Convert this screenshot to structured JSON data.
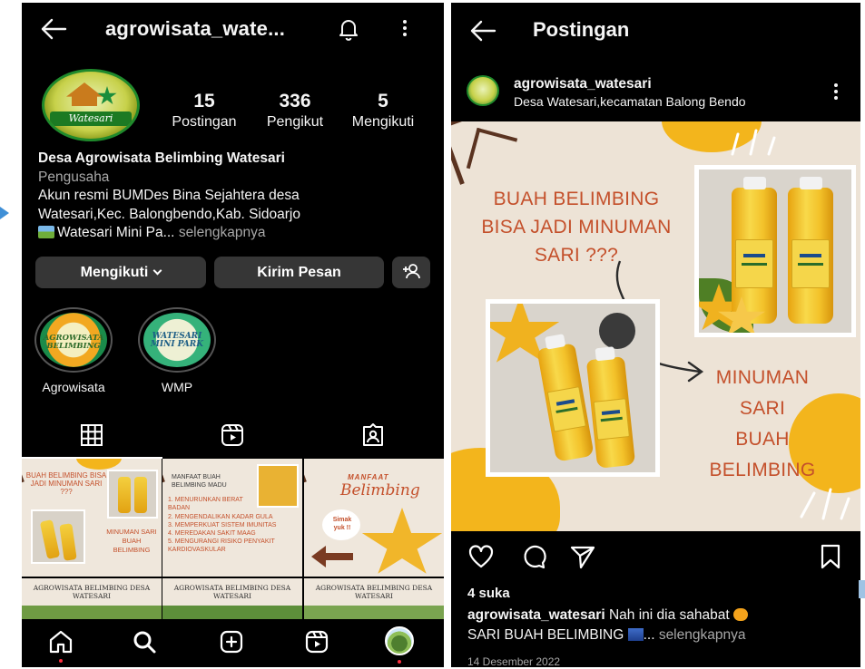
{
  "profile_screen": {
    "header": {
      "username": "agrowisata_wate...",
      "back_icon": "back-arrow-icon",
      "notify_icon": "bell-icon",
      "menu_icon": "more-vertical-icon"
    },
    "avatar_logo_text": "Watesari",
    "stats": [
      {
        "value": "15",
        "label": "Postingan"
      },
      {
        "value": "336",
        "label": "Pengikut"
      },
      {
        "value": "5",
        "label": "Mengikuti"
      }
    ],
    "bio": {
      "name": "Desa Agrowisata Belimbing Watesari",
      "category": "Pengusaha",
      "line1": "Akun resmi BUMDes Bina Sejahtera desa",
      "line2": "Watesari,Kec. Balongbendo,Kab. Sidoarjo",
      "line3": "Watesari Mini Pa...",
      "more": "selengkapnya"
    },
    "buttons": {
      "following": "Mengikuti",
      "message": "Kirim Pesan"
    },
    "highlights": [
      {
        "label": "Agrowisata",
        "cover_text": "AGROWISATA BELIMBING"
      },
      {
        "label": "WMP",
        "cover_text": "WATESARI MINI PARK"
      }
    ],
    "tabs": [
      "grid-icon",
      "reels-icon",
      "tagged-icon"
    ],
    "grid": {
      "post1": {
        "headline": "BUAH BELIMBING BISA JADI MINUMAN SARI ???",
        "result": "MINUMAN SARI BUAH BELIMBING"
      },
      "post2": {
        "title": "MANFAAT BUAH BELIMBING MADU",
        "items": [
          "1. MENURUNKAN BERAT BADAN",
          "2. MENGENDALIKAN KADAR GULA",
          "3. MEMPERKUAT SISTEM IMUNITAS",
          "4. MEREDAKAN SAKIT MAAG",
          "5. MENGURANGI RISIKO PENYAKIT KARDIOVASKULAR"
        ]
      },
      "post3": {
        "title1": "MANFAAT",
        "title2": "Belimbing",
        "bubble": "Simak yuk !!"
      },
      "row2_caption": "AGROWISATA BELIMBING DESA WATESARI"
    },
    "nav": [
      "home-icon",
      "search-icon",
      "create-icon",
      "reels-icon",
      "profile-avatar"
    ]
  },
  "post_screen": {
    "title": "Postingan",
    "username": "agrowisata_watesari",
    "location": "Desa Watesari,kecamatan Balong Bendo",
    "image": {
      "headline": [
        "BUAH BELIMBING",
        "BISA JADI MINUMAN",
        "SARI ???"
      ],
      "result": [
        "MINUMAN",
        "SARI",
        "BUAH",
        "BELIMBING"
      ],
      "bottle_brand": "SB",
      "bottle_label": "BELIMBING"
    },
    "likes": "4 suka",
    "caption": {
      "user": "agrowisata_watesari",
      "text1": "Nah ini dia sahabat",
      "text2": "SARI BUAH BELIMBING",
      "ellipsis": "...",
      "more": "selengkapnya"
    },
    "date": "14 Desember 2022"
  },
  "colors": {
    "background": "#000000",
    "button": "#363636",
    "muted_text": "#a8a8a8",
    "poster_text": "#c4502b",
    "poster_bg": "#ede3d6",
    "accent_yellow": "#f3b51c"
  }
}
